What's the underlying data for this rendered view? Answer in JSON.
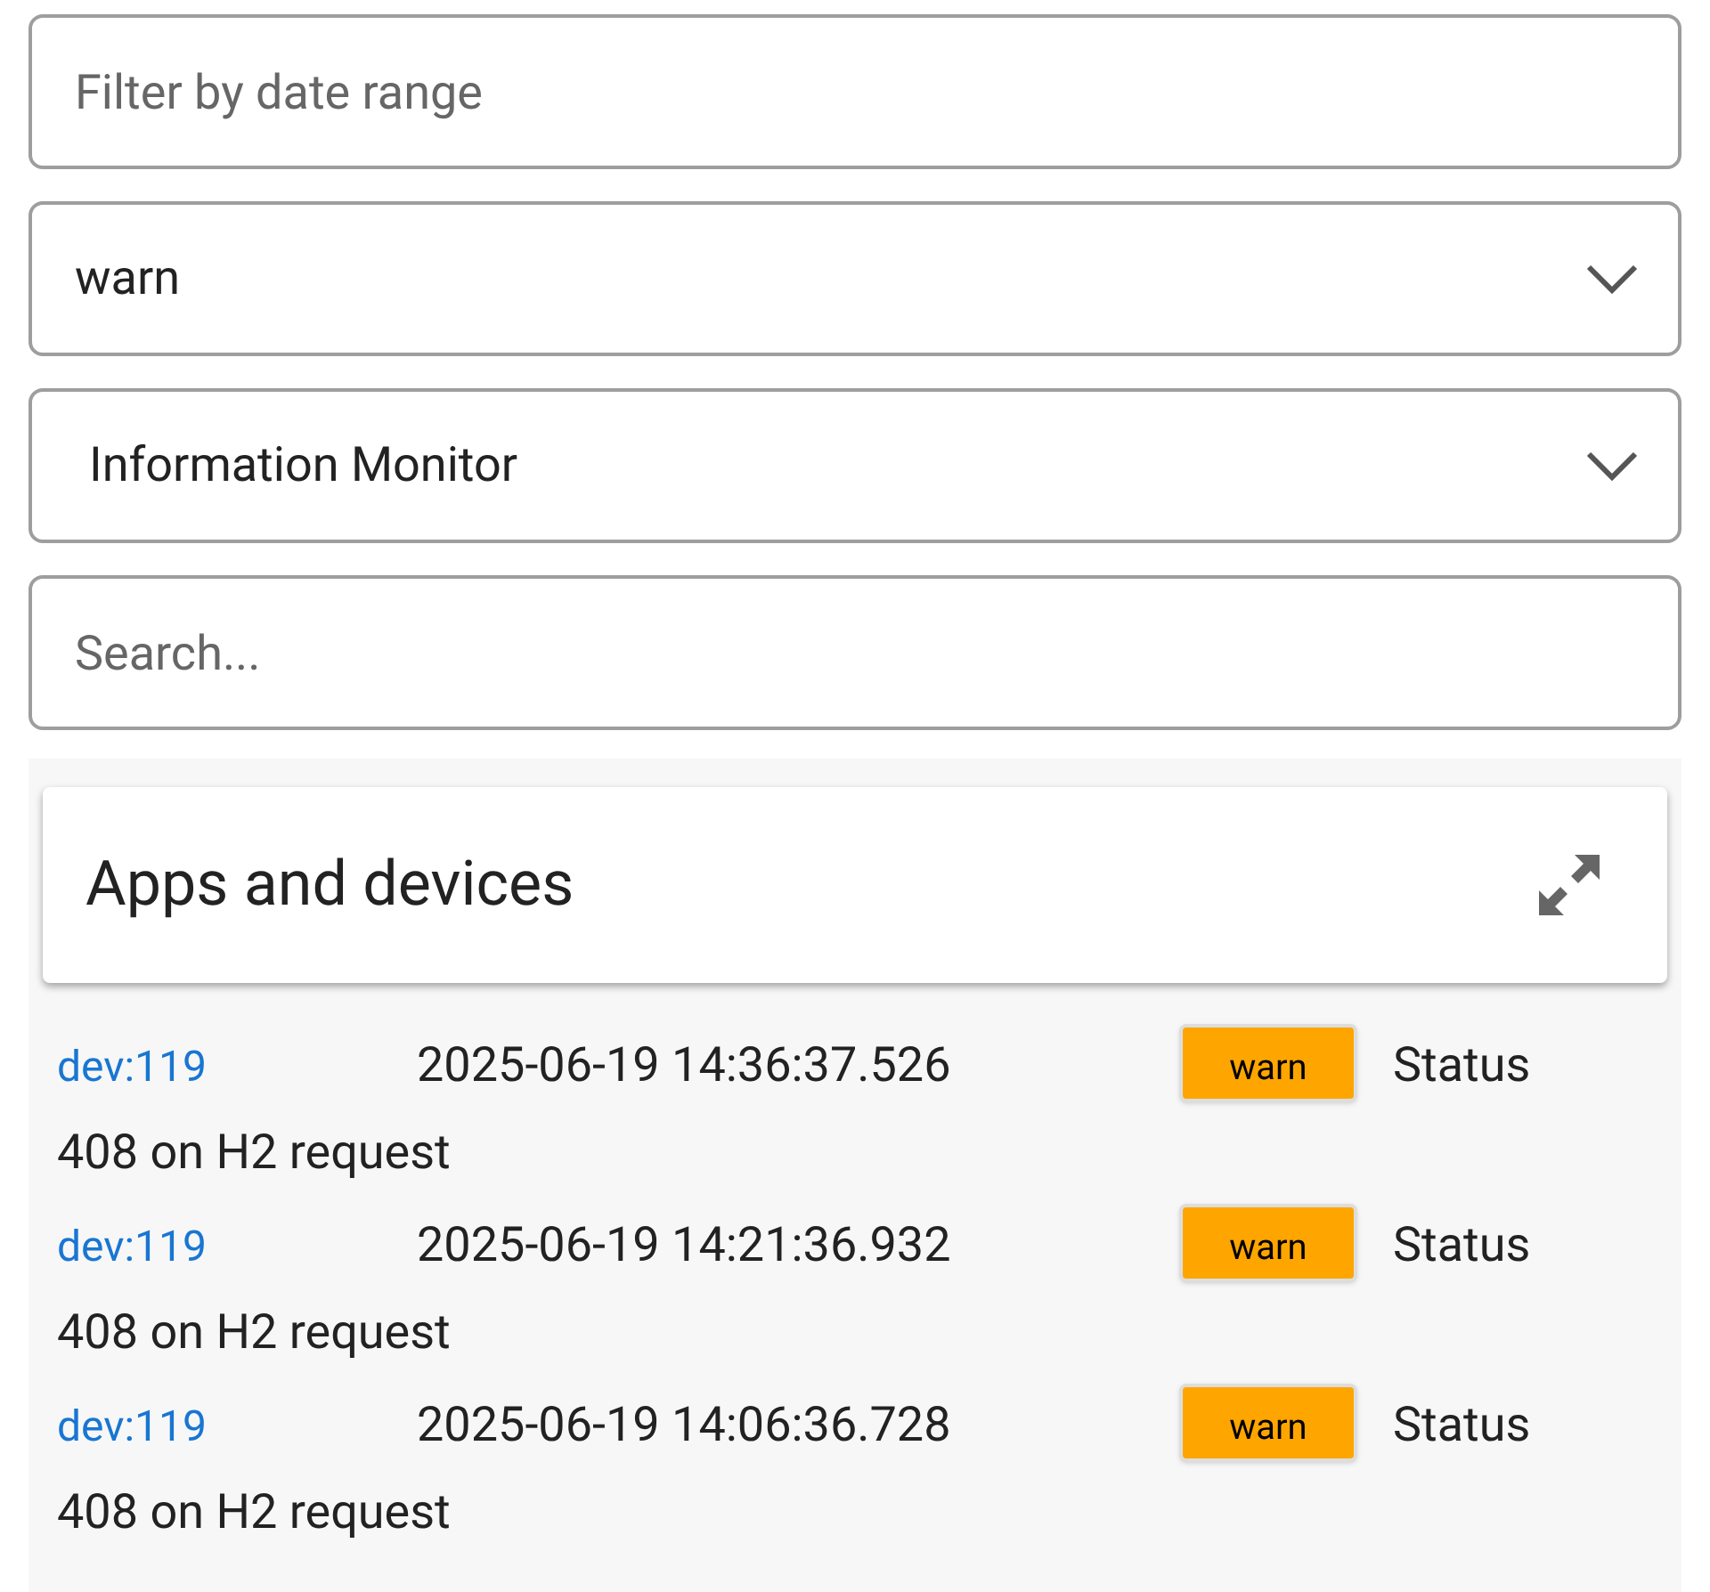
{
  "filters": {
    "date_range": {
      "placeholder": "Filter by date range"
    },
    "level_select": {
      "value": "warn"
    },
    "source_select": {
      "value": "Information Monitor"
    },
    "search": {
      "placeholder": "Search..."
    }
  },
  "panel": {
    "title": "Apps and devices"
  },
  "log_rows": [
    {
      "device": "dev:119",
      "time": "2025-06-19 14:36:37.526",
      "level": "warn",
      "color": "#ffa500",
      "message_lines": [
        "Status",
        "408 on H2 request"
      ]
    },
    {
      "device": "dev:119",
      "time": "2025-06-19 14:21:36.932",
      "level": "warn",
      "color": "#ffa500",
      "message_lines": [
        "Status",
        "408 on H2 request"
      ]
    },
    {
      "device": "dev:119",
      "time": "2025-06-19 14:06:36.728",
      "level": "warn",
      "color": "#ffa500",
      "message_lines": [
        "Status",
        "408 on H2 request"
      ]
    }
  ]
}
